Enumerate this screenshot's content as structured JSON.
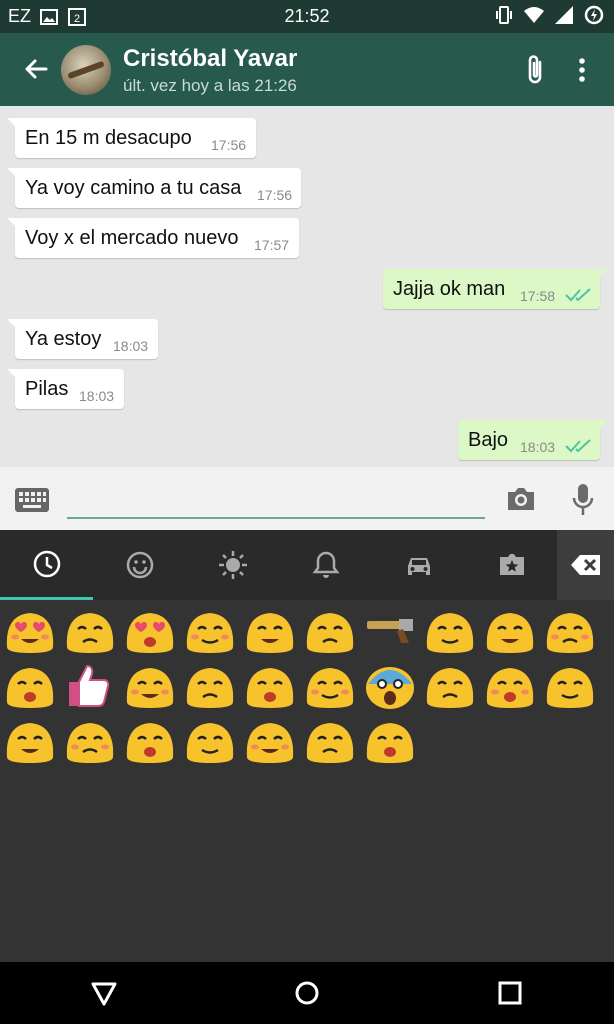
{
  "status_bar": {
    "left_text": "EZ",
    "time": "21:52"
  },
  "header": {
    "contact_name": "Cristóbal Yavar",
    "last_seen": "últ. vez hoy a las 21:26"
  },
  "messages": [
    {
      "direction": "in",
      "text": "En  15 m desacupo",
      "time": "17:56"
    },
    {
      "direction": "in",
      "text": "Ya voy camino a tu casa",
      "time": "17:56"
    },
    {
      "direction": "in",
      "text": "Voy x el mercado nuevo",
      "time": "17:57"
    },
    {
      "direction": "out",
      "text": "Jajja ok man",
      "time": "17:58",
      "status": "read"
    },
    {
      "direction": "in",
      "text": "Ya estoy",
      "time": "18:03"
    },
    {
      "direction": "in",
      "text": "Pilas",
      "time": "18:03"
    },
    {
      "direction": "out",
      "text": "Bajo",
      "time": "18:03",
      "status": "read"
    }
  ],
  "input": {
    "placeholder": "",
    "value": ""
  },
  "emoji_panel": {
    "active_tab": "recent",
    "tabs": [
      "recent-icon",
      "smiley-icon",
      "sun-icon",
      "bell-icon",
      "car-icon",
      "symbols-icon"
    ],
    "emojis": [
      "heart-eyes-emoji",
      "grinning-emoji",
      "kissing-heart-emoji",
      "smiling-blush-emoji",
      "relieved-emoji",
      "sad-tear-emoji",
      "pistol-emoji",
      "crying-loud-emoji",
      "unamused-emoji",
      "disappointed-emoji",
      "tongue-wink-emoji",
      "thumbs-up-emoji",
      "neutral-emoji",
      "persevering-emoji",
      "tired-face-emoji",
      "pensive-emoji",
      "screaming-fear-emoji",
      "angry-emoji",
      "pouting-emoji",
      "bowing-emoji",
      "sweat-emoji",
      "tongue-squint-emoji",
      "scream-hands-emoji",
      "sleepy-emoji",
      "kiss-emoji",
      "smirk-emoji",
      "wink-emoji"
    ]
  },
  "colors": {
    "appbar": "#27594d",
    "statusbar": "#1f3a33",
    "outgoing_bubble": "#dcf8c6",
    "read_ticks": "#4fc3a1",
    "emoji_yellow": "#f7c32d"
  }
}
